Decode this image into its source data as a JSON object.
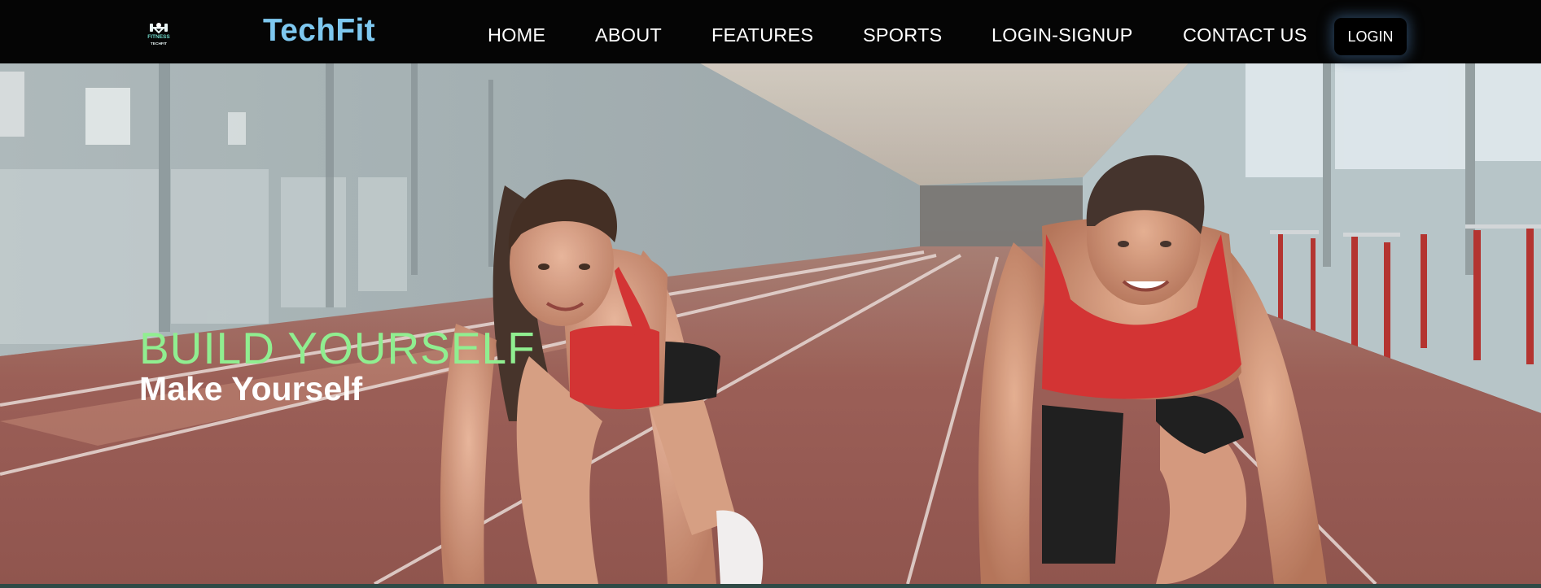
{
  "brand": {
    "name": "TechFit",
    "logo_text_top": "FITNESS",
    "logo_text_bottom": "TECHFIT",
    "logo_icon": "dumbbell-fitness-logo"
  },
  "nav": {
    "items": [
      {
        "label": "HOME"
      },
      {
        "label": "ABOUT"
      },
      {
        "label": "FEATURES"
      },
      {
        "label": "SPORTS"
      },
      {
        "label": "LOGIN-SIGNUP"
      },
      {
        "label": "CONTACT US"
      }
    ],
    "login_button": "LOGIN"
  },
  "hero": {
    "title": "BUILD YOURSELF",
    "subtitle": "Make Yourself",
    "image": "two-sprinters-starting-position-indoor-track"
  },
  "colors": {
    "navbar_bg": "#050505",
    "brand": "#7ec8f0",
    "hero_title": "#90ee90",
    "hero_subtitle": "#ffffff",
    "bottom_strip": "#2f4a46"
  }
}
